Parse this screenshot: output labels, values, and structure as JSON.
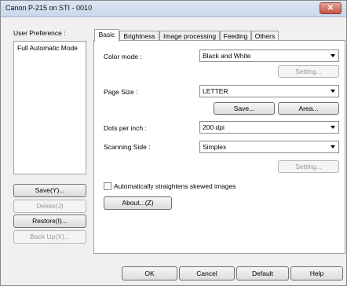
{
  "window": {
    "title": "Canon P-215 on STI - 0010",
    "close_label": "✕"
  },
  "user_preference": {
    "label": "User Preference :",
    "items": [
      "Full Automatic Mode"
    ],
    "save": "Save(Y)...",
    "delete": "Delete(J)",
    "restore": "Restore(I)...",
    "backup": "Back Up(X)..."
  },
  "tabs": [
    "Basic",
    "Brightness",
    "Image processing",
    "Feeding",
    "Others"
  ],
  "basic": {
    "color_mode_label": "Color mode :",
    "color_mode_value": "Black and White",
    "setting1": "Setting...",
    "page_size_label": "Page Size :",
    "page_size_value": "LETTER",
    "save": "Save...",
    "area": "Area...",
    "dpi_label": "Dots per inch :",
    "dpi_value": "200 dpi",
    "side_label": "Scanning Side :",
    "side_value": "Simplex",
    "setting2": "Setting...",
    "straighten_label": "Automatically straightens skewed images",
    "straighten_checked": false,
    "about": "About...(Z)"
  },
  "footer": {
    "ok": "OK",
    "cancel": "Cancel",
    "default": "Default",
    "help": "Help"
  }
}
